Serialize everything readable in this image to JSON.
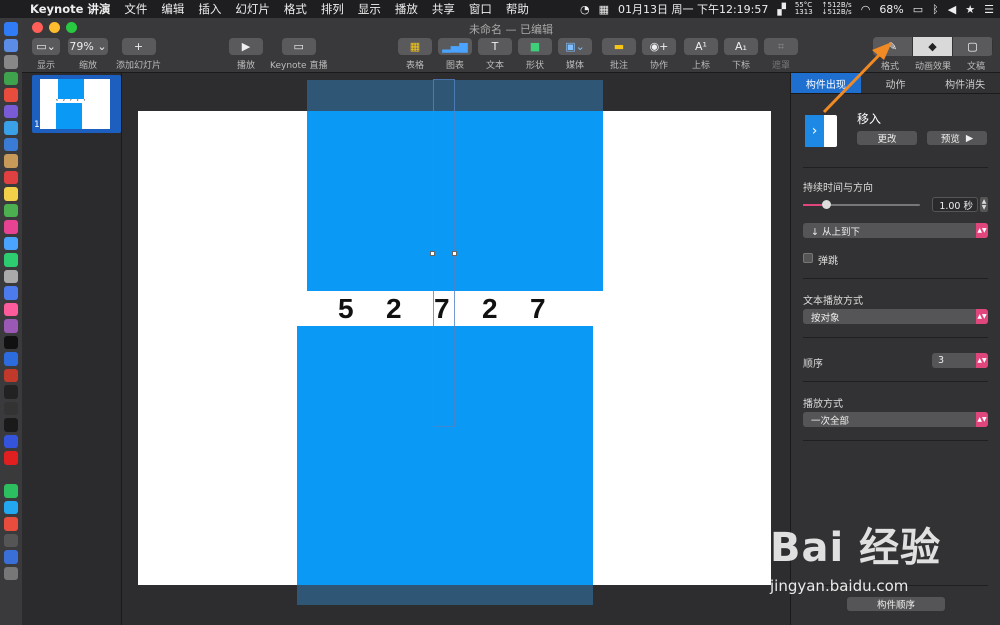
{
  "menubar": {
    "app_name": "Keynote 讲演",
    "items": [
      "文件",
      "编辑",
      "插入",
      "幻灯片",
      "格式",
      "排列",
      "显示",
      "播放",
      "共享",
      "窗口",
      "帮助"
    ],
    "temp": "55°C",
    "fan": "1313",
    "net_up": "↑512B/s",
    "net_down": "↓512B/s",
    "battery": "68%",
    "datetime": "01月13日 周一 下午12:19:57"
  },
  "toolbar": {
    "doc_title": "未命名 — 已编辑",
    "view_label": "显示",
    "zoom_value": "79%",
    "zoom_label": "缩放",
    "add_slide_label": "添加幻灯片",
    "play_label": "播放",
    "keynote_live_label": "Keynote 直播",
    "table_label": "表格",
    "chart_label": "图表",
    "text_label": "文本",
    "shape_label": "形状",
    "media_label": "媒体",
    "comment_label": "批注",
    "collaborate_label": "协作",
    "superscript_label": "上标",
    "subscript_label": "下标",
    "mask_label": "遮罩",
    "format_label": "格式",
    "animate_label": "动画效果",
    "document_label": "文稿"
  },
  "navigator": {
    "slide_number": "1",
    "thumb_text": "5 2 7 2 7"
  },
  "slide": {
    "digits": [
      "5",
      "2",
      "7",
      "2",
      "7"
    ]
  },
  "inspector": {
    "tabs": [
      "构件出现",
      "动作",
      "构件消失"
    ],
    "effect_name": "移入",
    "change_button": "更改",
    "preview_button": "预览",
    "duration_label": "持续时间与方向",
    "duration_value": "1.00 秒",
    "duration_fraction": 0.2,
    "direction_value": "↓  从上到下",
    "bounce_label": "弹跳",
    "text_delivery_label": "文本播放方式",
    "text_delivery_value": "按对象",
    "order_label": "顺序",
    "order_value": "3",
    "delivery_label": "播放方式",
    "delivery_value": "一次全部",
    "build_order_button": "构件顺序"
  },
  "watermark": {
    "big": "Bai  经验",
    "small": "jingyan.baidu.com"
  },
  "colors": {
    "slide_blue": "#0a99f5",
    "accent_pink": "#e0457b",
    "selection_blue": "#1f6fd1",
    "arrow_orange": "#f08a24"
  }
}
